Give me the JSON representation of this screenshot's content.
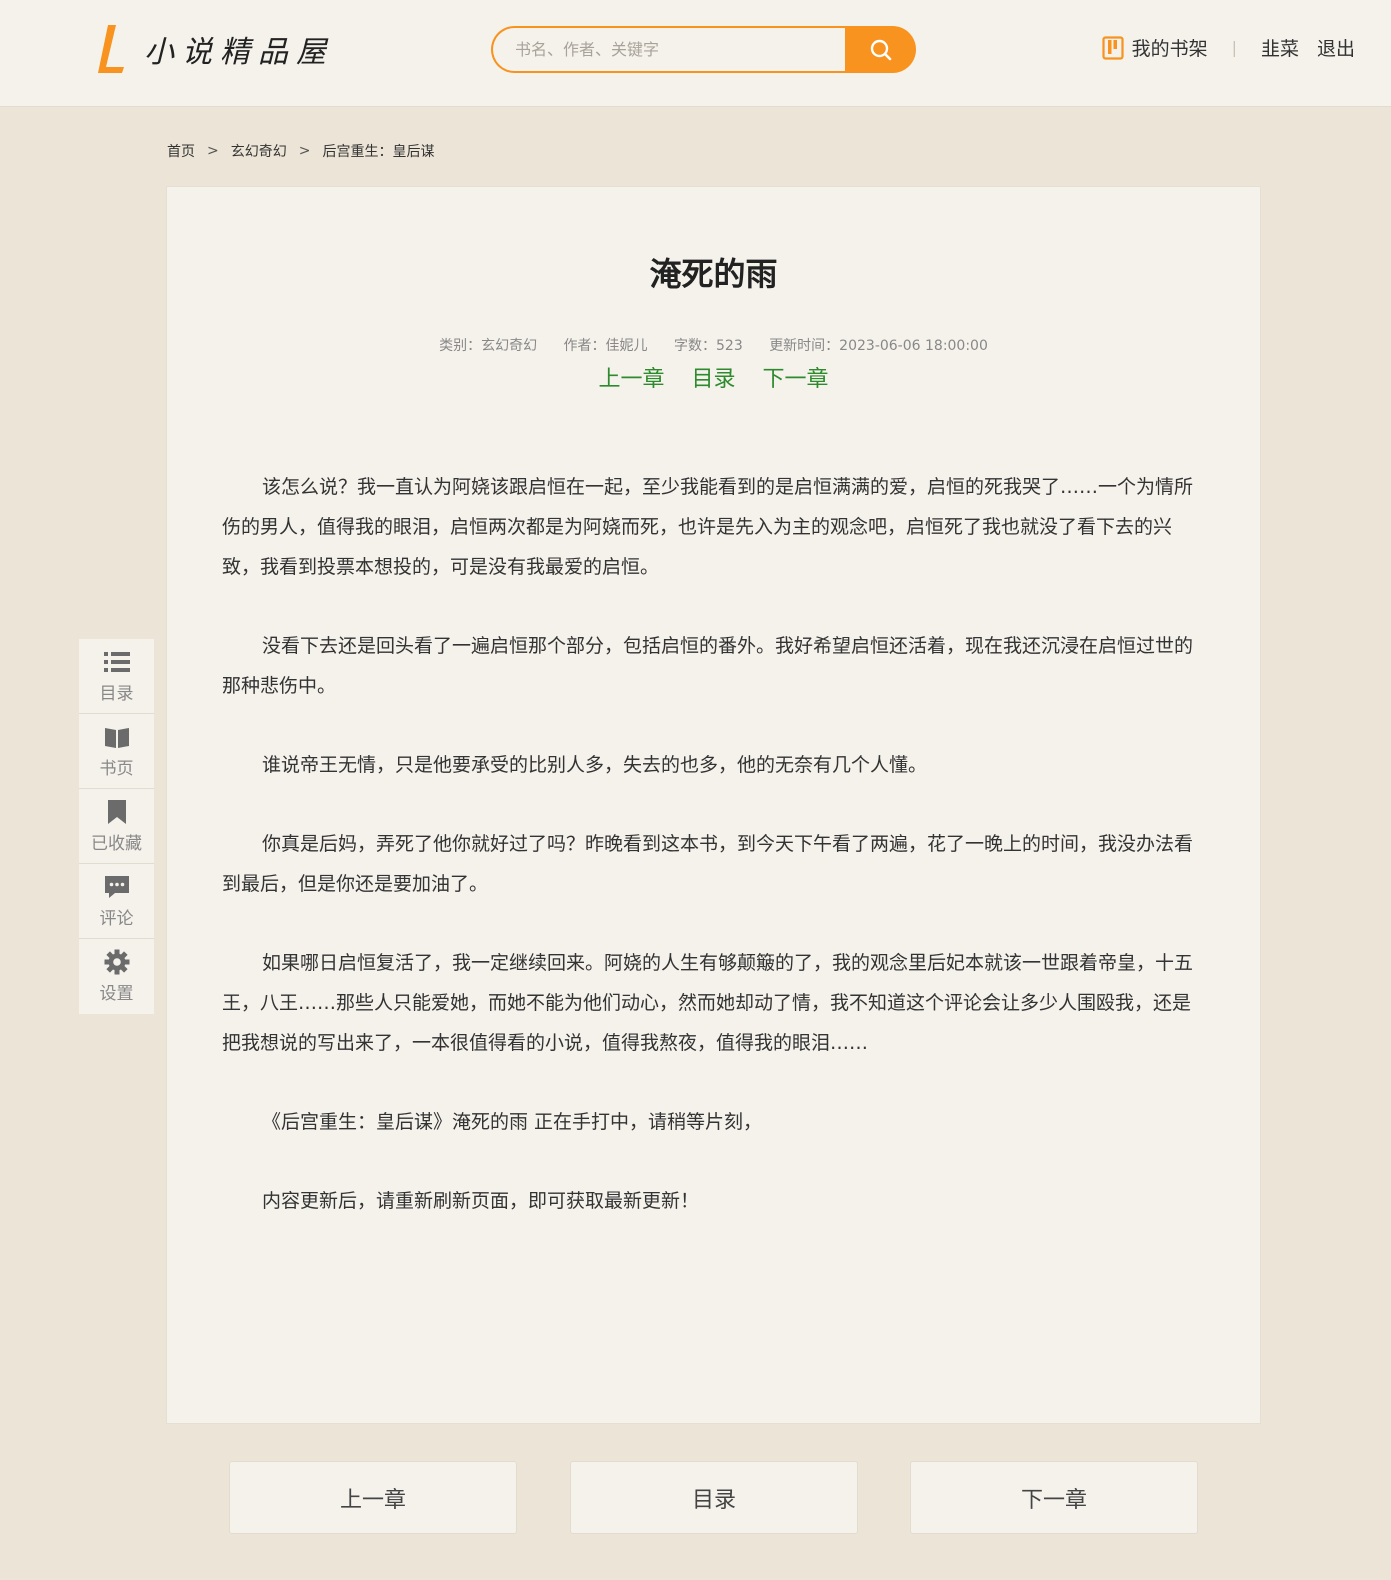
{
  "header": {
    "logo_text": "小说精品屋",
    "search": {
      "placeholder": "书名、作者、关键字",
      "value": ""
    },
    "shelf_label": "我的书架",
    "separator": "|",
    "username": "韭菜",
    "logout_label": "退出",
    "accent_color": "#f7931e"
  },
  "breadcrumb": {
    "home": "首页",
    "category": "玄幻奇幻",
    "book": "后宫重生：皇后谋",
    "arrow": ">"
  },
  "chapter": {
    "title": "淹死的雨",
    "meta": {
      "category": "类别：玄幻奇幻",
      "author": "作者：佳妮儿",
      "word_count": "字数：523",
      "updated": "更新时间：2023-06-06 18:00:00"
    },
    "nav": {
      "prev": "上一章",
      "toc": "目录",
      "next": "下一章"
    },
    "paragraphs": [
      "该怎么说？我一直认为阿娆该跟启恒在一起，至少我能看到的是启恒满满的爱，启恒的死我哭了……一个为情所伤的男人，值得我的眼泪，启恒两次都是为阿娆而死，也许是先入为主的观念吧，启恒死了我也就没了看下去的兴致，我看到投票本想投的，可是没有我最爱的启恒。",
      "没看下去还是回头看了一遍启恒那个部分，包括启恒的番外。我好希望启恒还活着，现在我还沉浸在启恒过世的那种悲伤中。",
      "谁说帝王无情，只是他要承受的比别人多，失去的也多，他的无奈有几个人懂。",
      "你真是后妈，弄死了他你就好过了吗？昨晚看到这本书，到今天下午看了两遍，花了一晚上的时间，我没办法看到最后，但是你还是要加油了。",
      "如果哪日启恒复活了，我一定继续回来。阿娆的人生有够颠簸的了，我的观念里后妃本就该一世跟着帝皇，十五王，八王……那些人只能爱她，而她不能为他们动心，然而她却动了情，我不知道这个评论会让多少人围殴我，还是把我想说的写出来了，一本很值得看的小说，值得我熬夜，值得我的眼泪……",
      "《后宫重生：皇后谋》淹死的雨 正在手打中，请稍等片刻，",
      "内容更新后，请重新刷新页面，即可获取最新更新！"
    ],
    "nav_color": "#2d8a2d"
  },
  "sidebar": {
    "items": [
      {
        "label": "目录",
        "icon": "list-icon"
      },
      {
        "label": "书页",
        "icon": "book-icon"
      },
      {
        "label": "已收藏",
        "icon": "bookmark-icon"
      },
      {
        "label": "评论",
        "icon": "comment-icon"
      },
      {
        "label": "设置",
        "icon": "gear-icon"
      }
    ]
  },
  "footer_nav": {
    "prev": "上一章",
    "toc": "目录",
    "next": "下一章"
  }
}
